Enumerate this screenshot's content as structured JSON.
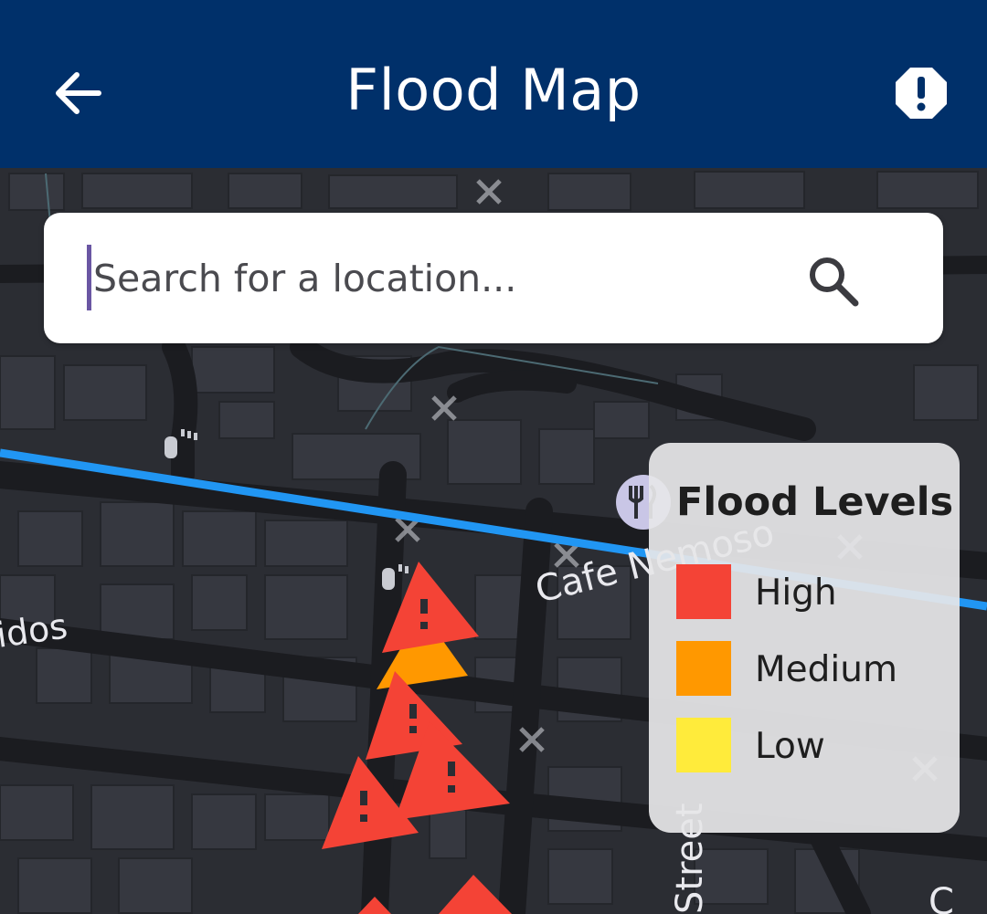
{
  "app_bar": {
    "title": "Flood Map",
    "back_icon": "arrow-left-icon",
    "alert_icon": "octagon-alert-icon",
    "background": "#00306a"
  },
  "search": {
    "placeholder": "Search for a location...",
    "value": "",
    "icon": "search-icon"
  },
  "map": {
    "labels": {
      "cafe": "Cafe Nemoso",
      "left_street": "idos",
      "street": "Street",
      "edge_letter": "C"
    },
    "route_color": "#2196f3",
    "markers": [
      {
        "level": "High"
      },
      {
        "level": "Medium"
      },
      {
        "level": "High"
      },
      {
        "level": "High"
      },
      {
        "level": "High"
      },
      {
        "level": "High"
      },
      {
        "level": "High"
      }
    ]
  },
  "legend": {
    "title": "Flood Levels",
    "items": [
      {
        "label": "High",
        "color": "#f44336"
      },
      {
        "label": "Medium",
        "color": "#ff9800"
      },
      {
        "label": "Low",
        "color": "#ffeb3b"
      }
    ]
  }
}
